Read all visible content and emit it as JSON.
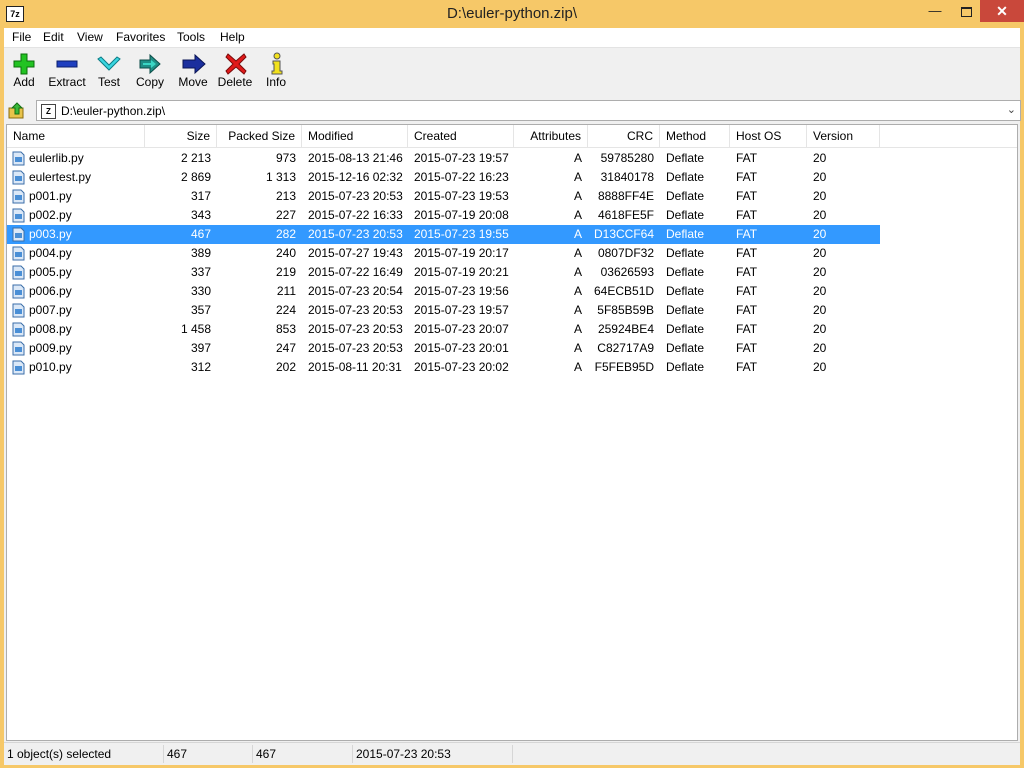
{
  "window": {
    "title": "D:\\euler-python.zip\\",
    "app_icon": "7z"
  },
  "menu": [
    "File",
    "Edit",
    "View",
    "Favorites",
    "Tools",
    "Help"
  ],
  "toolbar": [
    {
      "label": "Add",
      "icon": "plus-icon"
    },
    {
      "label": "Extract",
      "icon": "minus-icon"
    },
    {
      "label": "Test",
      "icon": "check-icon"
    },
    {
      "label": "Copy",
      "icon": "double-arrow-icon"
    },
    {
      "label": "Move",
      "icon": "arrow-right-icon"
    },
    {
      "label": "Delete",
      "icon": "x-icon"
    },
    {
      "label": "Info",
      "icon": "info-icon"
    }
  ],
  "address": {
    "path": "D:\\euler-python.zip\\"
  },
  "columns": [
    "Name",
    "Size",
    "Packed Size",
    "Modified",
    "Created",
    "Attributes",
    "CRC",
    "Method",
    "Host OS",
    "Version"
  ],
  "files": [
    {
      "name": "eulerlib.py",
      "size": "2 213",
      "packed": "973",
      "modified": "2015-08-13 21:46",
      "created": "2015-07-23 19:57",
      "attr": "A",
      "crc": "59785280",
      "method": "Deflate",
      "host": "FAT",
      "version": "20",
      "selected": false
    },
    {
      "name": "eulertest.py",
      "size": "2 869",
      "packed": "1 313",
      "modified": "2015-12-16 02:32",
      "created": "2015-07-22 16:23",
      "attr": "A",
      "crc": "31840178",
      "method": "Deflate",
      "host": "FAT",
      "version": "20",
      "selected": false
    },
    {
      "name": "p001.py",
      "size": "317",
      "packed": "213",
      "modified": "2015-07-23 20:53",
      "created": "2015-07-23 19:53",
      "attr": "A",
      "crc": "8888FF4E",
      "method": "Deflate",
      "host": "FAT",
      "version": "20",
      "selected": false
    },
    {
      "name": "p002.py",
      "size": "343",
      "packed": "227",
      "modified": "2015-07-22 16:33",
      "created": "2015-07-19 20:08",
      "attr": "A",
      "crc": "4618FE5F",
      "method": "Deflate",
      "host": "FAT",
      "version": "20",
      "selected": false
    },
    {
      "name": "p003.py",
      "size": "467",
      "packed": "282",
      "modified": "2015-07-23 20:53",
      "created": "2015-07-23 19:55",
      "attr": "A",
      "crc": "D13CCF64",
      "method": "Deflate",
      "host": "FAT",
      "version": "20",
      "selected": true
    },
    {
      "name": "p004.py",
      "size": "389",
      "packed": "240",
      "modified": "2015-07-27 19:43",
      "created": "2015-07-19 20:17",
      "attr": "A",
      "crc": "0807DF32",
      "method": "Deflate",
      "host": "FAT",
      "version": "20",
      "selected": false
    },
    {
      "name": "p005.py",
      "size": "337",
      "packed": "219",
      "modified": "2015-07-22 16:49",
      "created": "2015-07-19 20:21",
      "attr": "A",
      "crc": "03626593",
      "method": "Deflate",
      "host": "FAT",
      "version": "20",
      "selected": false
    },
    {
      "name": "p006.py",
      "size": "330",
      "packed": "211",
      "modified": "2015-07-23 20:54",
      "created": "2015-07-23 19:56",
      "attr": "A",
      "crc": "64ECB51D",
      "method": "Deflate",
      "host": "FAT",
      "version": "20",
      "selected": false
    },
    {
      "name": "p007.py",
      "size": "357",
      "packed": "224",
      "modified": "2015-07-23 20:53",
      "created": "2015-07-23 19:57",
      "attr": "A",
      "crc": "5F85B59B",
      "method": "Deflate",
      "host": "FAT",
      "version": "20",
      "selected": false
    },
    {
      "name": "p008.py",
      "size": "1 458",
      "packed": "853",
      "modified": "2015-07-23 20:53",
      "created": "2015-07-23 20:07",
      "attr": "A",
      "crc": "25924BE4",
      "method": "Deflate",
      "host": "FAT",
      "version": "20",
      "selected": false
    },
    {
      "name": "p009.py",
      "size": "397",
      "packed": "247",
      "modified": "2015-07-23 20:53",
      "created": "2015-07-23 20:01",
      "attr": "A",
      "crc": "C82717A9",
      "method": "Deflate",
      "host": "FAT",
      "version": "20",
      "selected": false
    },
    {
      "name": "p010.py",
      "size": "312",
      "packed": "202",
      "modified": "2015-08-11 20:31",
      "created": "2015-07-23 20:02",
      "attr": "A",
      "crc": "F5FEB95D",
      "method": "Deflate",
      "host": "FAT",
      "version": "20",
      "selected": false
    }
  ],
  "status": {
    "selection": "1 object(s) selected",
    "size": "467",
    "packed": "467",
    "modified": "2015-07-23 20:53"
  },
  "colors": {
    "title_bg": "#f6c868",
    "close_btn": "#c9483b",
    "selection": "#3399ff"
  }
}
